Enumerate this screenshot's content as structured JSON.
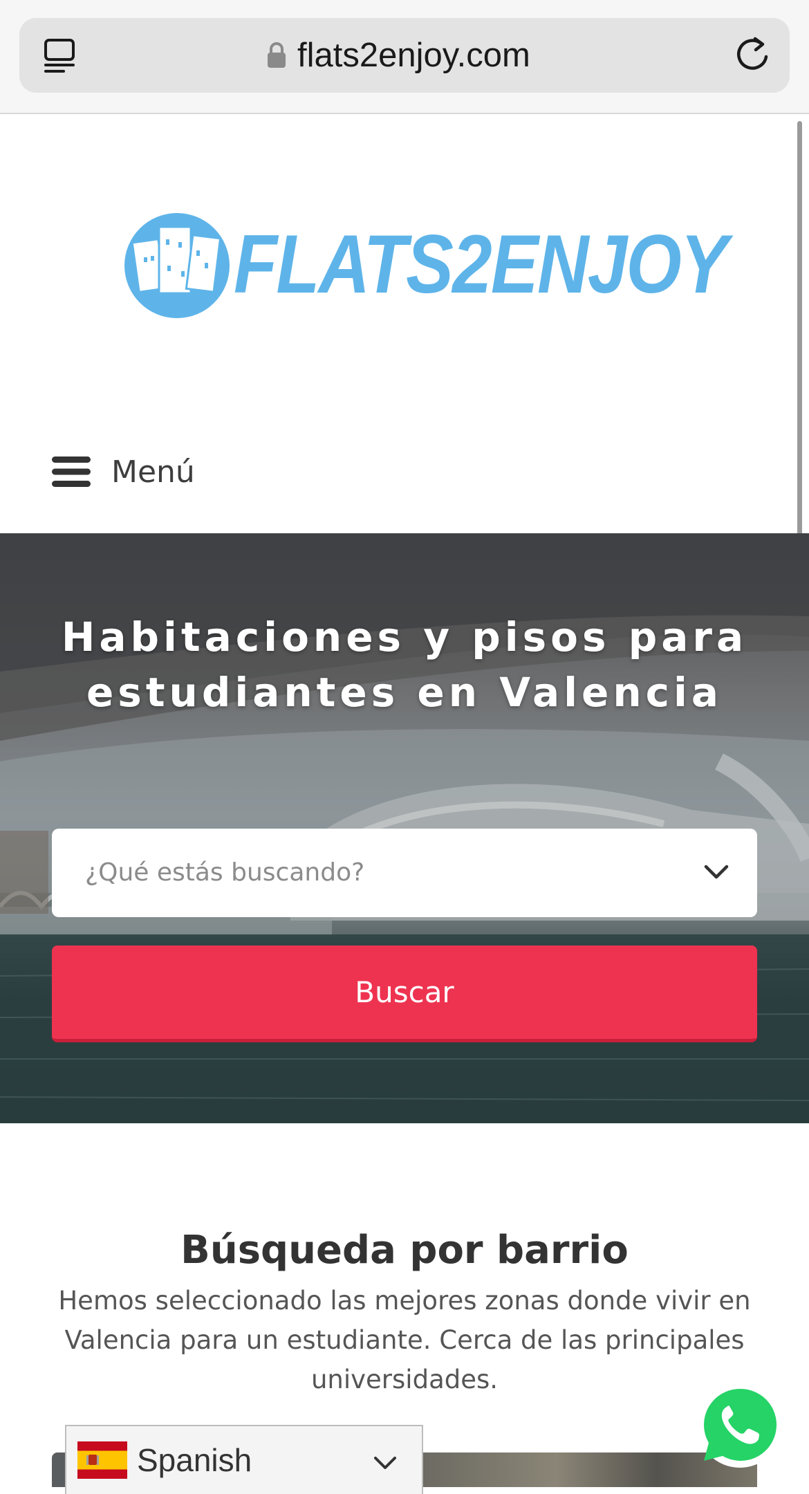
{
  "browser": {
    "url": "flats2enjoy.com",
    "icons": {
      "tabs": "tabs-overview-icon",
      "lock": "lock-icon",
      "reload": "reload-icon"
    }
  },
  "header": {
    "logo_text": "FLATS2ENJOY",
    "menu_label": "Menú",
    "menu_icon": "hamburger-icon"
  },
  "hero": {
    "title": "Habitaciones y pisos para estudiantes en Valencia",
    "search": {
      "placeholder": "¿Qué estás buscando?",
      "icon": "chevron-down-icon"
    },
    "search_button": "Buscar"
  },
  "neighborhood": {
    "title": "Búsqueda por barrio",
    "description": "Hemos seleccionado las mejores zonas donde vivir en Valencia para un estudiante. Cerca de las principales universidades."
  },
  "language": {
    "selected": "Spanish",
    "flag_icon": "spain-flag-icon"
  },
  "whatsapp": {
    "icon": "whatsapp-icon"
  },
  "colors": {
    "brand_blue": "#5eb4e9",
    "accent_red": "#ee3350",
    "whatsapp_green": "#25d366"
  }
}
